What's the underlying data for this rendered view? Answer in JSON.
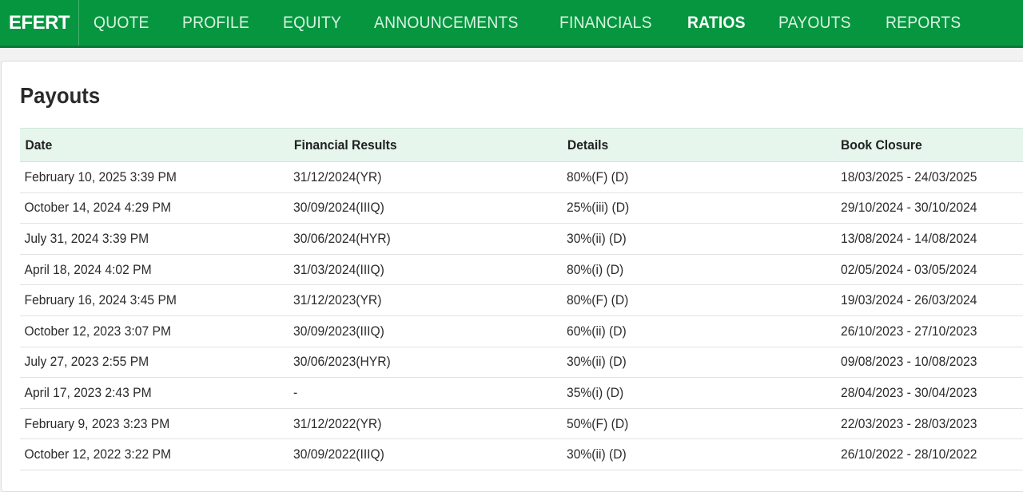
{
  "nav": {
    "symbol": "EFERT",
    "tabs": [
      {
        "label": "QUOTE"
      },
      {
        "label": "PROFILE"
      },
      {
        "label": "EQUITY"
      },
      {
        "label": "ANNOUNCEMENTS"
      },
      {
        "label": "FINANCIALS"
      },
      {
        "label": "RATIOS"
      },
      {
        "label": "PAYOUTS"
      },
      {
        "label": "REPORTS"
      }
    ],
    "active_tab": "RATIOS"
  },
  "page": {
    "title": "Payouts"
  },
  "table": {
    "headers": [
      "Date",
      "Financial Results",
      "Details",
      "Book Closure"
    ],
    "rows": [
      [
        "February 10, 2025 3:39 PM",
        "31/12/2024(YR)",
        "80%(F) (D)",
        "18/03/2025 - 24/03/2025"
      ],
      [
        "October 14, 2024 4:29 PM",
        "30/09/2024(IIIQ)",
        "25%(iii) (D)",
        "29/10/2024 - 30/10/2024"
      ],
      [
        "July 31, 2024 3:39 PM",
        "30/06/2024(HYR)",
        "30%(ii) (D)",
        "13/08/2024 - 14/08/2024"
      ],
      [
        "April 18, 2024 4:02 PM",
        "31/03/2024(IIIQ)",
        "80%(i) (D)",
        "02/05/2024 - 03/05/2024"
      ],
      [
        "February 16, 2024 3:45 PM",
        "31/12/2023(YR)",
        "80%(F) (D)",
        "19/03/2024 - 26/03/2024"
      ],
      [
        "October 12, 2023 3:07 PM",
        "30/09/2023(IIIQ)",
        "60%(ii) (D)",
        "26/10/2023 - 27/10/2023"
      ],
      [
        "July 27, 2023 2:55 PM",
        "30/06/2023(HYR)",
        "30%(ii) (D)",
        "09/08/2023 - 10/08/2023"
      ],
      [
        "April 17, 2023 2:43 PM",
        "-",
        "35%(i) (D)",
        "28/04/2023 - 30/04/2023"
      ],
      [
        "February 9, 2023 3:23 PM",
        "31/12/2022(YR)",
        "50%(F) (D)",
        "22/03/2023 - 28/03/2023"
      ],
      [
        "October 12, 2022 3:22 PM",
        "30/09/2022(IIIQ)",
        "30%(ii) (D)",
        "26/10/2022 - 28/10/2022"
      ]
    ]
  },
  "colors": {
    "nav_bg": "#06963f",
    "header_row_bg": "#e6f6ec"
  }
}
